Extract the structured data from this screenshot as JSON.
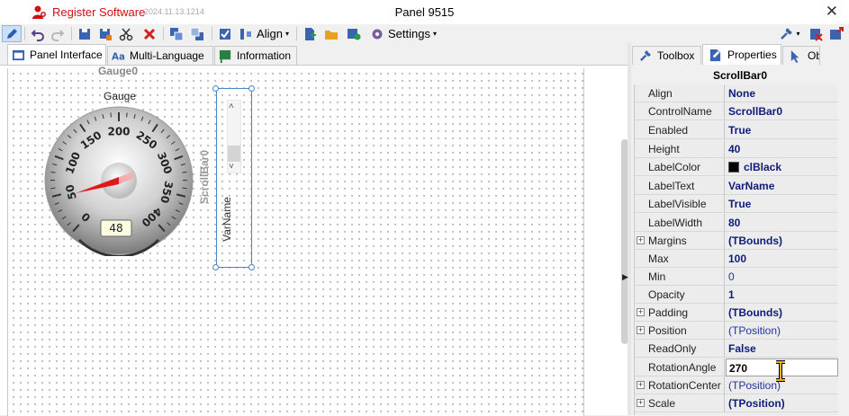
{
  "titlebar": {
    "register_label": "Register Software",
    "version": "2024.11.13.1214",
    "title": "Panel 9515",
    "close_glyph": "✕"
  },
  "toolbar": {
    "align_label": "Align",
    "settings_label": "Settings",
    "caret": "▾"
  },
  "tabs": [
    {
      "label": "Panel Interface"
    },
    {
      "label": "Multi-Language"
    },
    {
      "label": "Information"
    }
  ],
  "canvas": {
    "gauge_name": "Gauge0",
    "gauge_label": "Gauge",
    "gauge_value": "48",
    "gauge_ticks": [
      "0",
      "50",
      "100",
      "150",
      "200",
      "250",
      "300",
      "350",
      "400"
    ],
    "scrollbar_name": "ScrollBar0",
    "scrollbar_label": "VarName",
    "up_glyph": "˄",
    "down_glyph": "˅"
  },
  "right_panel": {
    "tabs": [
      {
        "label": "Toolbox"
      },
      {
        "label": "Properties"
      },
      {
        "label": "Ob"
      }
    ],
    "selected_object": "ScrollBar0",
    "expander_glyph": "+",
    "properties": [
      {
        "name": "Align",
        "value": "None"
      },
      {
        "name": "ControlName",
        "value": "ScrollBar0"
      },
      {
        "name": "Enabled",
        "value": "True"
      },
      {
        "name": "Height",
        "value": "40"
      },
      {
        "name": "LabelColor",
        "value": "clBlack"
      },
      {
        "name": "LabelText",
        "value": "VarName"
      },
      {
        "name": "LabelVisible",
        "value": "True"
      },
      {
        "name": "LabelWidth",
        "value": "80"
      },
      {
        "name": "Margins",
        "value": "(TBounds)"
      },
      {
        "name": "Max",
        "value": "100"
      },
      {
        "name": "Min",
        "value": "0"
      },
      {
        "name": "Opacity",
        "value": "1"
      },
      {
        "name": "Padding",
        "value": "(TBounds)"
      },
      {
        "name": "Position",
        "value": "(TPosition)"
      },
      {
        "name": "ReadOnly",
        "value": "False"
      },
      {
        "name": "RotationAngle",
        "value": "270"
      },
      {
        "name": "RotationCenter",
        "value": "(TPosition)"
      },
      {
        "name": "Scale",
        "value": "(TPosition)"
      }
    ]
  },
  "colors": {
    "accent_red": "#d01010",
    "value_blue": "#101b7a",
    "selection_blue": "#4a86c8"
  }
}
